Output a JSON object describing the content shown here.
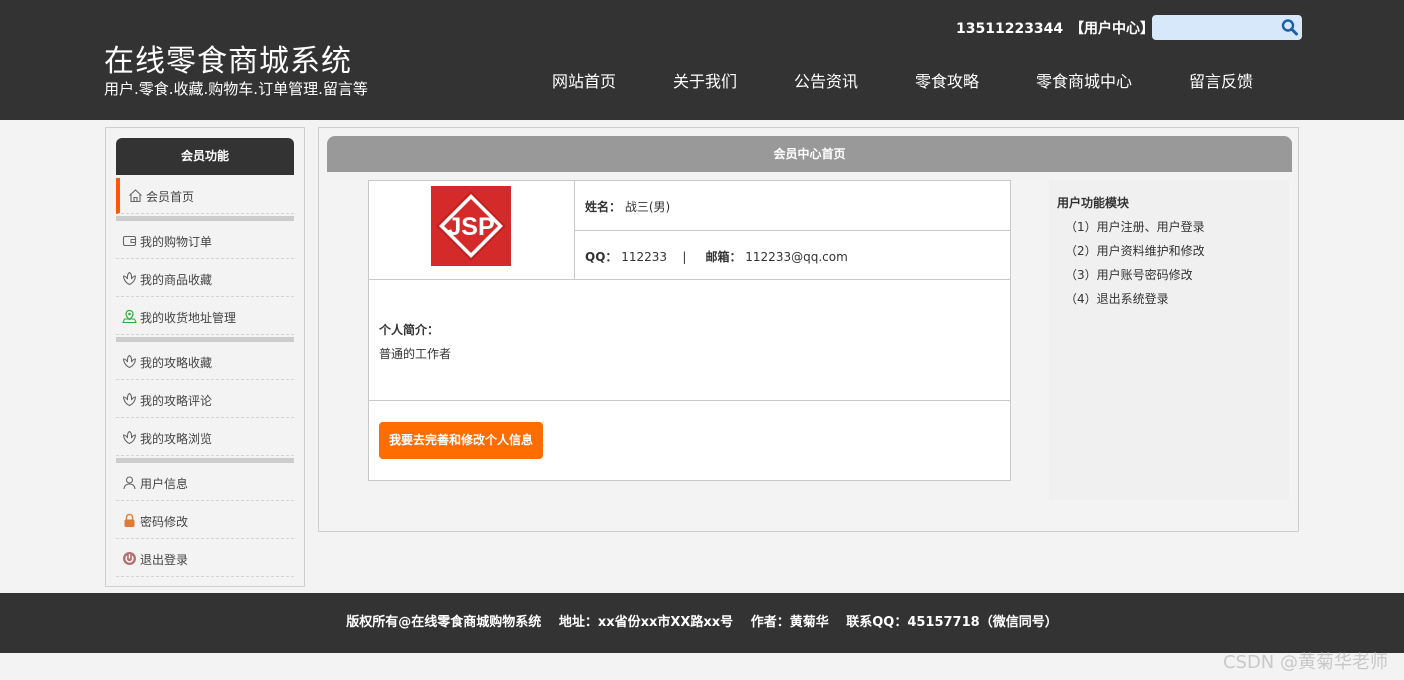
{
  "header": {
    "title": "在线零食商城系统",
    "subtitle": "用户.零食.收藏.购物车.订单管理.留言等",
    "phone": "13511223344",
    "user_center": "【用户中心】",
    "search_placeholder": "",
    "nav": [
      "网站首页",
      "关于我们",
      "公告资讯",
      "零食攻略",
      "零食商城中心",
      "留言反馈"
    ]
  },
  "sidebar": {
    "title": "会员功能",
    "items": [
      {
        "label": "会员首页",
        "icon": "home-icon"
      },
      {
        "label": "我的购物订单",
        "icon": "wallet-icon"
      },
      {
        "label": "我的商品收藏",
        "icon": "flower-icon"
      },
      {
        "label": "我的收货地址管理",
        "icon": "location-icon"
      },
      {
        "label": "我的攻略收藏",
        "icon": "flower-icon"
      },
      {
        "label": "我的攻略评论",
        "icon": "flower-icon"
      },
      {
        "label": "我的攻略浏览",
        "icon": "flower-icon"
      },
      {
        "label": "用户信息",
        "icon": "user-icon"
      },
      {
        "label": "密码修改",
        "icon": "lock-icon"
      },
      {
        "label": "退出登录",
        "icon": "power-icon"
      }
    ]
  },
  "main": {
    "title": "会员中心首页",
    "avatar_text": "JSP",
    "name_label": "姓名：",
    "name_value": "战三(男)",
    "qq_label": "QQ：",
    "qq_value": "112233",
    "separator": "|",
    "email_label": "邮箱：",
    "email_value": "112233@qq.com",
    "intro_label": "个人简介：",
    "intro_text": "普通的工作者",
    "edit_button": "我要去完善和修改个人信息"
  },
  "modules": {
    "title": "用户功能模块",
    "items": [
      "（1）用户注册、用户登录",
      "（2）用户资料维护和修改",
      "（3）用户账号密码修改",
      "（4）退出系统登录"
    ]
  },
  "footer": {
    "text": "版权所有@在线零食商城购物系统　 地址：xx省份xx市XX路xx号　 作者：黄菊华　 联系QQ：45157718（微信同号）"
  },
  "watermark": "CSDN @黄菊华老师",
  "colors": {
    "header_bg": "#333333",
    "accent_orange": "#ff6c00",
    "main_head_bg": "#999999"
  }
}
